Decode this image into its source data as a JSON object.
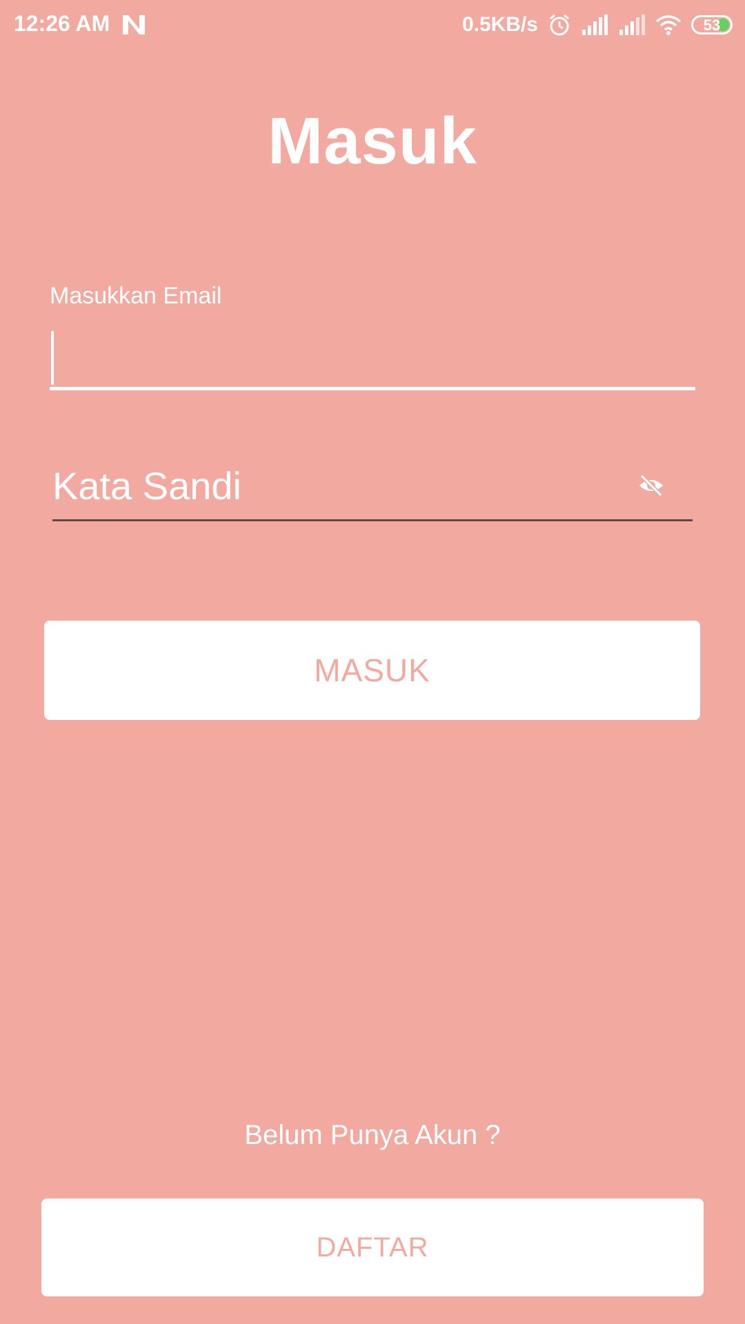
{
  "status_bar": {
    "time": "12:26 AM",
    "network_speed": "0.5KB/s",
    "battery_level": "53",
    "icons": [
      "n-notification-icon",
      "alarm-icon",
      "signal-icon",
      "signal-icon-2",
      "wifi-icon",
      "battery-icon"
    ]
  },
  "page": {
    "title": "Masuk"
  },
  "form": {
    "email_label": "Masukkan Email",
    "email_value": "",
    "password_placeholder": "Kata Sandi",
    "password_toggle_icon": "eye-off-icon"
  },
  "actions": {
    "login_label": "MASUK",
    "no_account_text": "Belum Punya Akun ?",
    "register_label": "DAFTAR"
  },
  "colors": {
    "background": "#f1a9a0",
    "button_bg": "#ffffff",
    "button_text": "#f1a9a0",
    "battery_fill": "#5fd35b"
  }
}
